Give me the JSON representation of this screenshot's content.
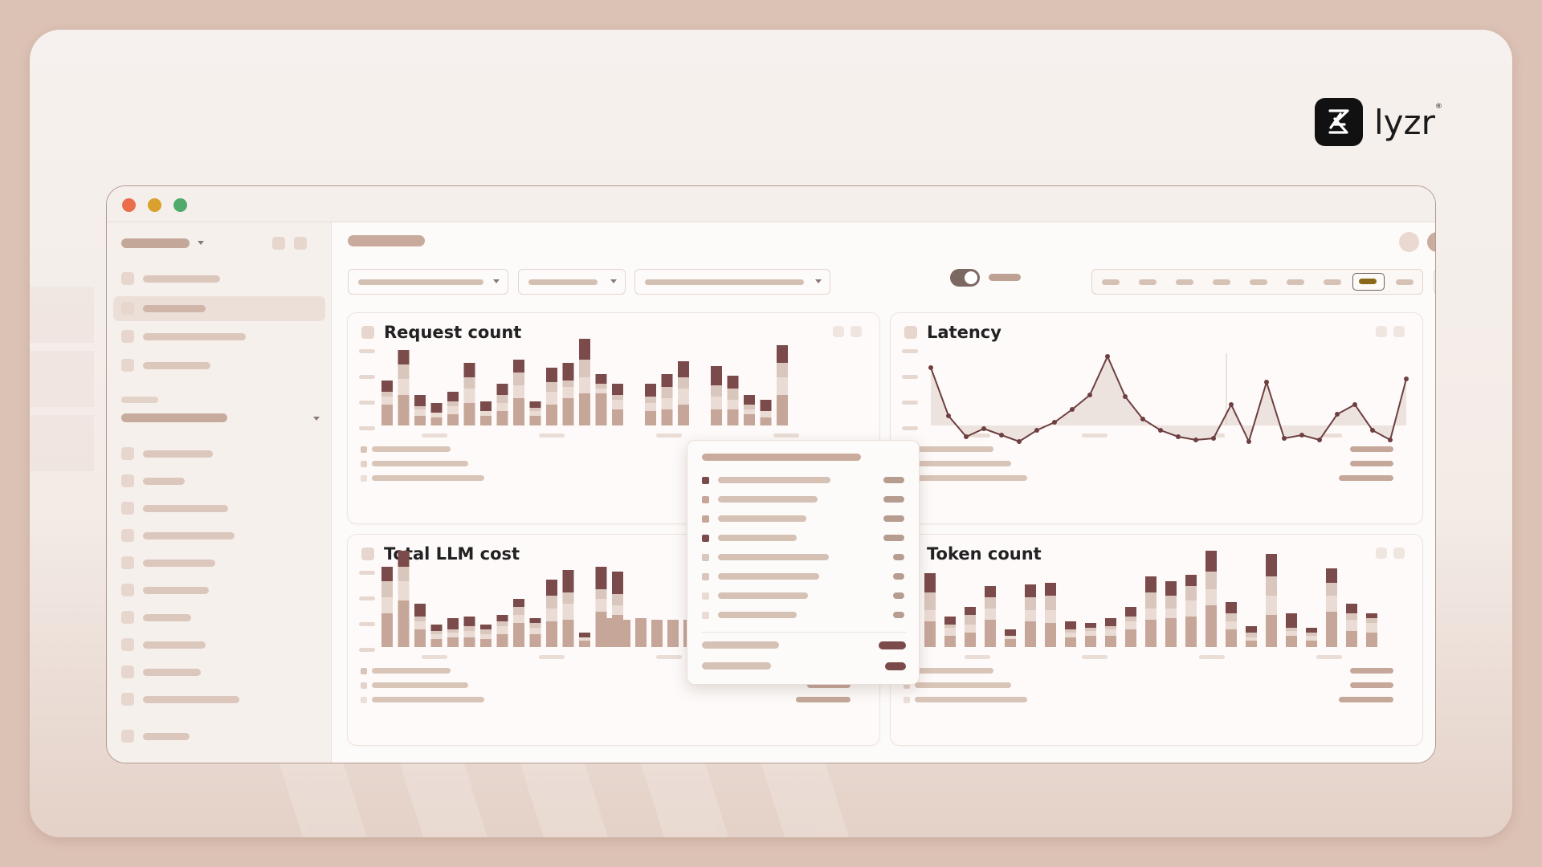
{
  "brand": {
    "name": "lyzr",
    "mark": "lyzr-logo-icon"
  },
  "window": {
    "traffic_lights": {
      "close": "#ea6d4c",
      "minimize": "#d9a02d",
      "maximize": "#4faa6c"
    }
  },
  "colors": {
    "dark": "#7a4b4a",
    "mid": "#d9c6bc",
    "light": "#c7a69a",
    "pale": "#eadcd4",
    "line": "#6e3f40",
    "area": "#ede3de",
    "accent_gold": "#8a6a1a"
  },
  "panels": {
    "request": {
      "title": "Request count"
    },
    "latency": {
      "title": "Latency"
    },
    "cost": {
      "title": "Total LLM cost"
    },
    "tokens": {
      "title": "Token count"
    }
  },
  "icons": {
    "caret": "chevron-down-icon",
    "toggle": "toggle-icon",
    "bullet": "legend-square-icon"
  }
}
